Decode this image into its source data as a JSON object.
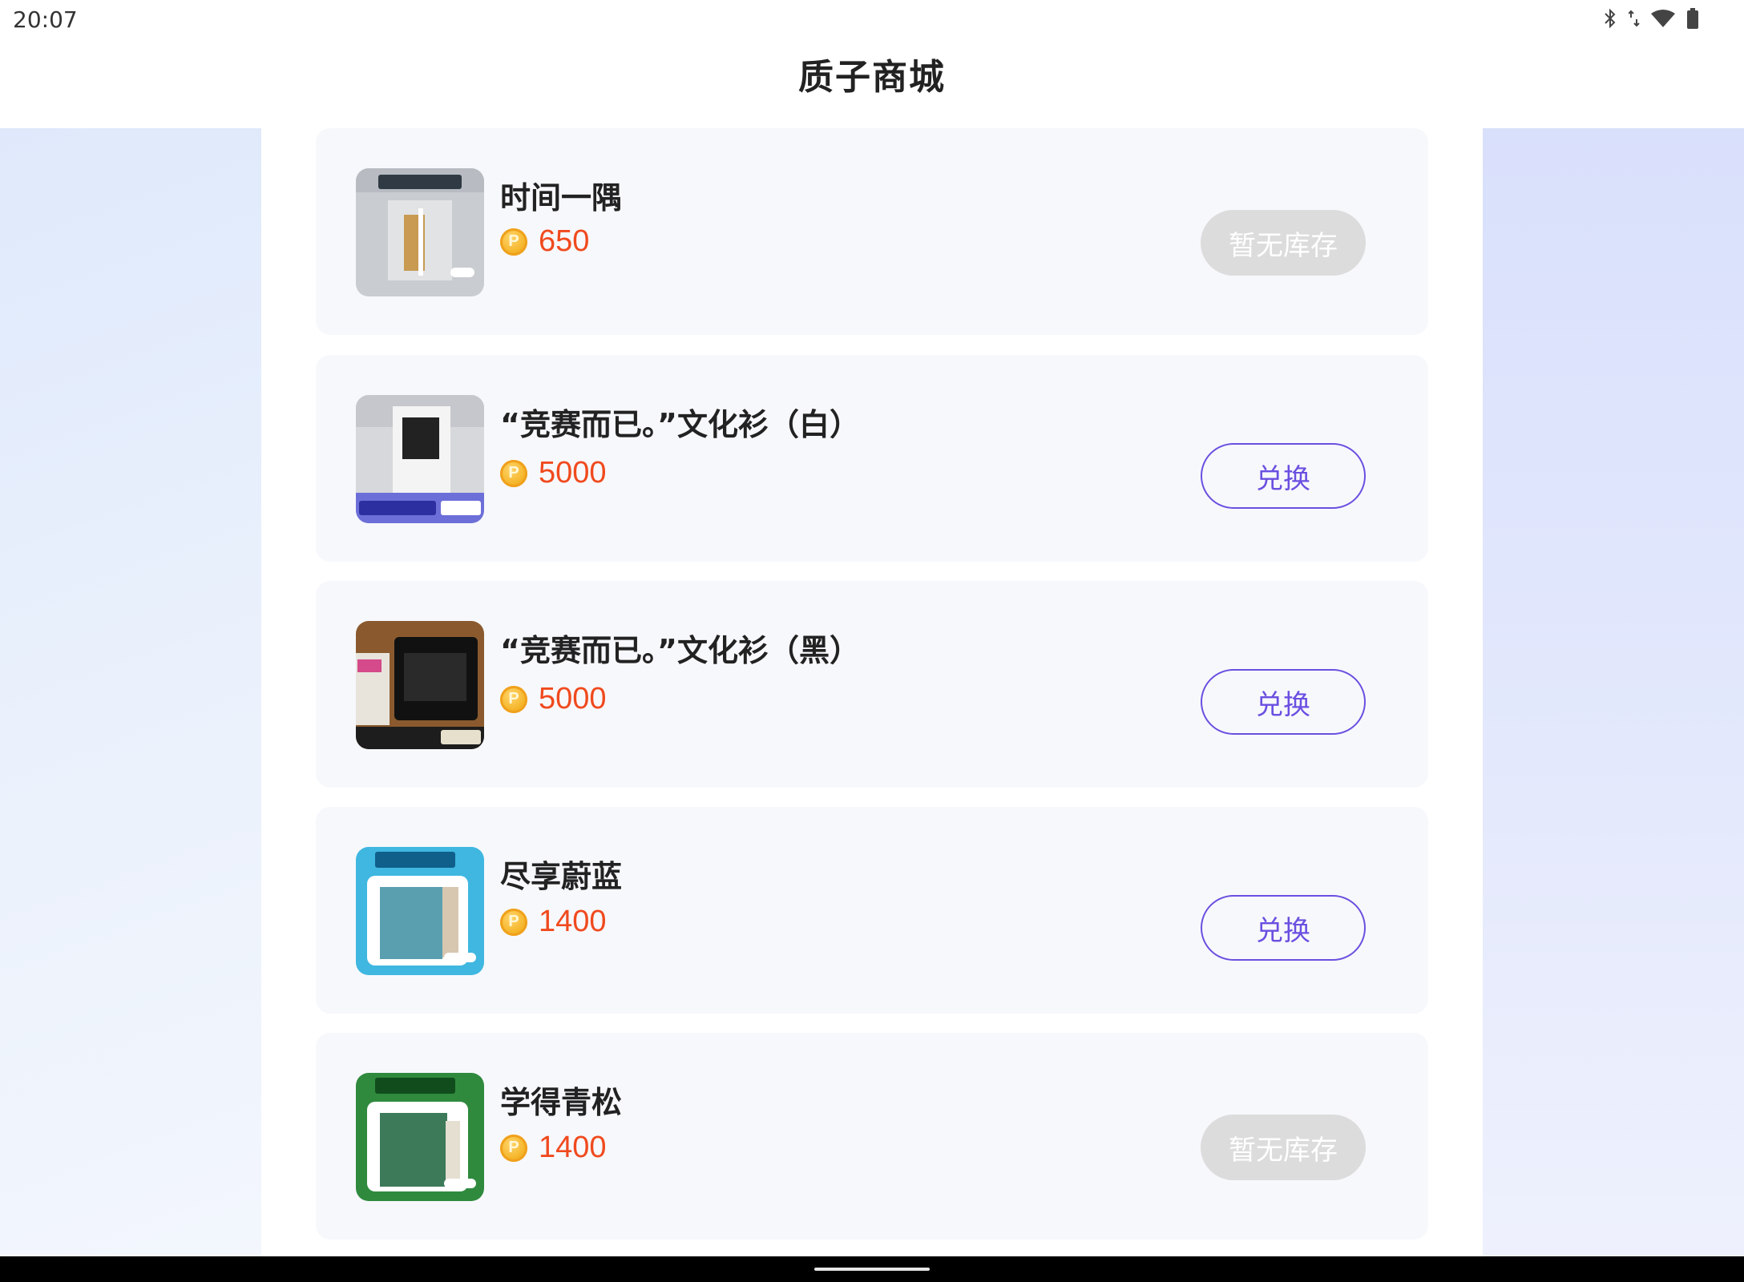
{
  "status_bar": {
    "time": "20:07",
    "icons": [
      "bluetooth-icon",
      "signal-icon",
      "wifi-icon",
      "battery-icon"
    ]
  },
  "header": {
    "title": "质子商城"
  },
  "currency_icon_letter": "P",
  "products": [
    {
      "name": "时间一隅",
      "price": "650",
      "button_label": "暂无库存",
      "in_stock": false,
      "thumb_theme": "gray"
    },
    {
      "name": "“竞赛而已。”文化衫（白）",
      "price": "5000",
      "button_label": "兑换",
      "in_stock": true,
      "thumb_theme": "white-shirt"
    },
    {
      "name": "“竞赛而已。”文化衫（黑）",
      "price": "5000",
      "button_label": "兑换",
      "in_stock": true,
      "thumb_theme": "black-shirt"
    },
    {
      "name": "尽享蔚蓝",
      "price": "1400",
      "button_label": "兑换",
      "in_stock": true,
      "thumb_theme": "blue"
    },
    {
      "name": "学得青松",
      "price": "1400",
      "button_label": "暂无库存",
      "in_stock": false,
      "thumb_theme": "green"
    }
  ],
  "colors": {
    "accent": "#6b4fe0",
    "price": "#f04a1e",
    "soldout_bg": "#dcdcdc"
  }
}
